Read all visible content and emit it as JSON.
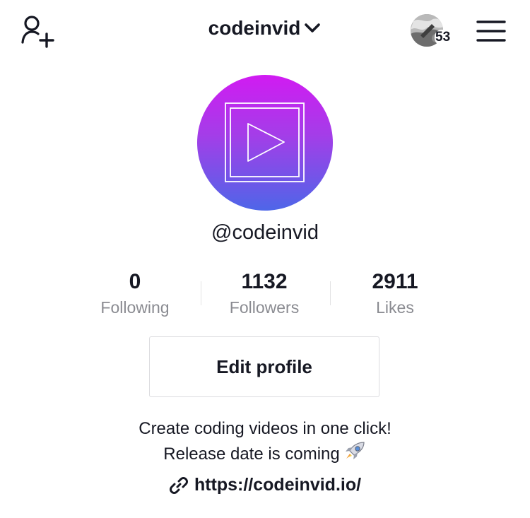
{
  "header": {
    "username": "codeinvid",
    "notification_count": "53",
    "add_friend_icon": "add-user-icon",
    "menu_icon": "hamburger-menu-icon",
    "dropdown_icon": "chevron-down-icon"
  },
  "profile": {
    "handle": "@codeinvid",
    "avatar_icon": "play-button-icon",
    "avatar_gradient": [
      "#d11bf2",
      "#4e66e8"
    ]
  },
  "stats": [
    {
      "value": "0",
      "label": "Following"
    },
    {
      "value": "1132",
      "label": "Followers"
    },
    {
      "value": "2911",
      "label": "Likes"
    }
  ],
  "actions": {
    "edit_profile": "Edit profile"
  },
  "bio": {
    "line1": "Create coding videos in one click!",
    "line2": "Release date is coming",
    "emoji": "rocket-icon"
  },
  "link": {
    "url": "https://codeinvid.io/",
    "icon": "link-icon"
  },
  "colors": {
    "text": "#161823",
    "muted": "#8a8b91",
    "border": "#dcdcdf"
  }
}
